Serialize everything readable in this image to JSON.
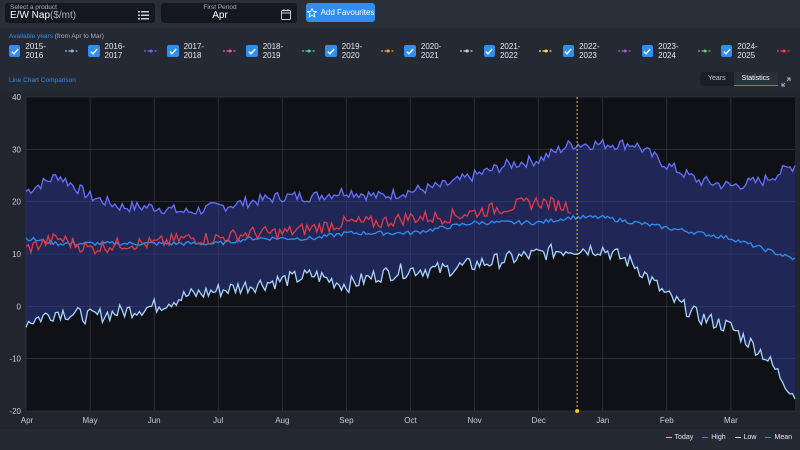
{
  "header": {
    "product_label": "Select a product",
    "product_value": "E/W Nap",
    "product_unit": "($/mt)",
    "period_label": "First Period",
    "period_value": "Apr",
    "fav_button": "Add Favourites"
  },
  "available": {
    "label": "Available years",
    "sub": "(from Apr to Mar)"
  },
  "years": [
    {
      "label": "2015-2016",
      "color": "#8ab4f8"
    },
    {
      "label": "2016-2017",
      "color": "#6b6bf0"
    },
    {
      "label": "2017-2018",
      "color": "#ff4fa3"
    },
    {
      "label": "2018-2019",
      "color": "#3ce0b0"
    },
    {
      "label": "2019-2020",
      "color": "#f5a623"
    },
    {
      "label": "2020-2021",
      "color": "#d0d4dc"
    },
    {
      "label": "2021-2022",
      "color": "#ffe04a"
    },
    {
      "label": "2022-2023",
      "color": "#c04be8"
    },
    {
      "label": "2023-2024",
      "color": "#4ed94e"
    },
    {
      "label": "2024-2025",
      "color": "#ff3b3b"
    }
  ],
  "chart_title": "Line Chart Comparison",
  "tabs": {
    "years": "Years",
    "statistics": "Statistics"
  },
  "legend": {
    "today": "Today",
    "high": "High",
    "low": "Low",
    "mean": "Mean"
  },
  "colors": {
    "accent": "#2f8ef0",
    "high": "#6570ff",
    "low": "#a6d4ff",
    "mean": "#2f8ef0",
    "current": "#e53945",
    "today": "#f5c518"
  },
  "chart_data": {
    "type": "line",
    "x_ticks": [
      "Apr",
      "May",
      "Jun",
      "Jul",
      "Aug",
      "Sep",
      "Oct",
      "Nov",
      "Dec",
      "Jan",
      "Feb",
      "Mar"
    ],
    "ylim": [
      -20,
      40
    ],
    "y_ticks": [
      40,
      30,
      20,
      10,
      0,
      -10,
      -20
    ],
    "today_index": 8.6,
    "series": [
      {
        "name": "High",
        "x": [
          0,
          0.5,
          1,
          1.5,
          2,
          2.5,
          3,
          3.5,
          4,
          4.5,
          5,
          5.5,
          6,
          6.5,
          7,
          7.5,
          8,
          8.5,
          9,
          9.5,
          10,
          10.5,
          11,
          11.5,
          12
        ],
        "values": [
          22,
          25,
          21,
          19,
          19,
          18,
          19,
          20,
          21,
          21,
          22,
          21,
          22,
          23,
          25,
          27,
          28,
          31,
          31,
          31,
          27,
          24,
          23,
          24,
          27
        ]
      },
      {
        "name": "Low",
        "x": [
          0,
          0.5,
          1,
          1.5,
          2,
          2.5,
          3,
          3.5,
          4,
          4.5,
          5,
          5.5,
          6,
          6.5,
          7,
          7.5,
          8,
          8.5,
          9,
          9.5,
          10,
          10.5,
          11,
          11.5,
          12
        ],
        "values": [
          -3,
          -1,
          -2,
          -1,
          0,
          2,
          3,
          4,
          5,
          6,
          4,
          6,
          7,
          7,
          8,
          9,
          10,
          11,
          11,
          8,
          2,
          -2,
          -4,
          -9,
          -17
        ]
      },
      {
        "name": "Mean",
        "x": [
          0,
          0.5,
          1,
          1.5,
          2,
          2.5,
          3,
          3.5,
          4,
          4.5,
          5,
          5.5,
          6,
          6.5,
          7,
          7.5,
          8,
          8.5,
          9,
          9.5,
          10,
          10.5,
          11,
          11.5,
          12
        ],
        "values": [
          13,
          12,
          12,
          12,
          12,
          12,
          12,
          13,
          13,
          13,
          14,
          14,
          14,
          15,
          16,
          16,
          16,
          17,
          17,
          16,
          15,
          14,
          13,
          11,
          9
        ]
      },
      {
        "name": "2024-2025",
        "x": [
          0,
          0.5,
          1,
          1.5,
          2,
          2.5,
          3,
          3.5,
          4,
          4.5,
          5,
          5.5,
          6,
          6.5,
          7,
          7.5,
          8,
          8.5
        ],
        "values": [
          11,
          13,
          11,
          12,
          12,
          13,
          13,
          14,
          14,
          15,
          16,
          16,
          17,
          17,
          18,
          19,
          20,
          19
        ]
      }
    ]
  }
}
